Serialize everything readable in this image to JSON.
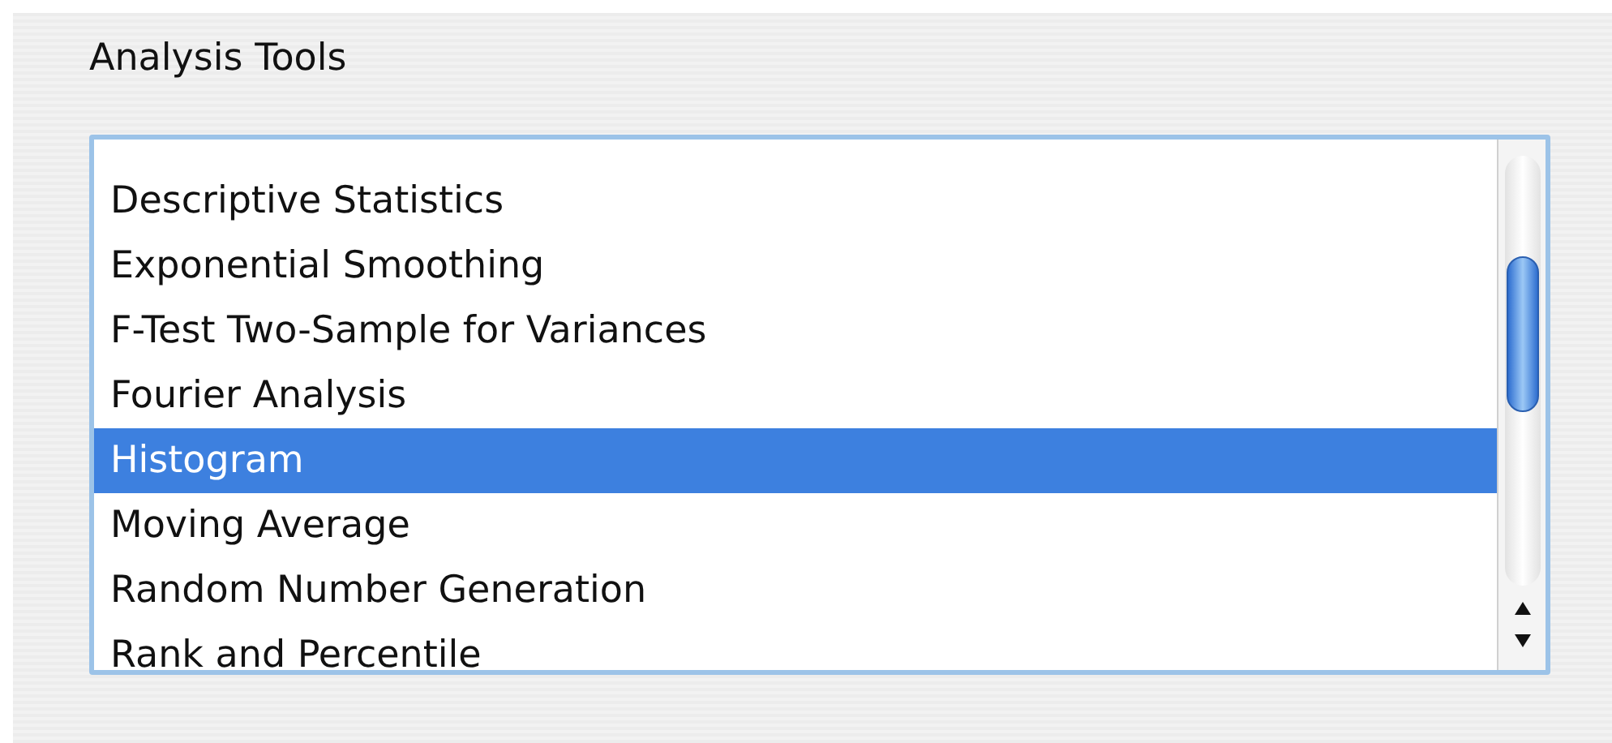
{
  "group_label": "Analysis Tools",
  "tools": [
    {
      "label": "Descriptive Statistics",
      "selected": false
    },
    {
      "label": "Exponential Smoothing",
      "selected": false
    },
    {
      "label": "F-Test Two-Sample for Variances",
      "selected": false
    },
    {
      "label": "Fourier Analysis",
      "selected": false
    },
    {
      "label": "Histogram",
      "selected": true
    },
    {
      "label": "Moving Average",
      "selected": false
    },
    {
      "label": "Random Number Generation",
      "selected": false
    },
    {
      "label": "Rank and Percentile",
      "selected": false
    }
  ]
}
